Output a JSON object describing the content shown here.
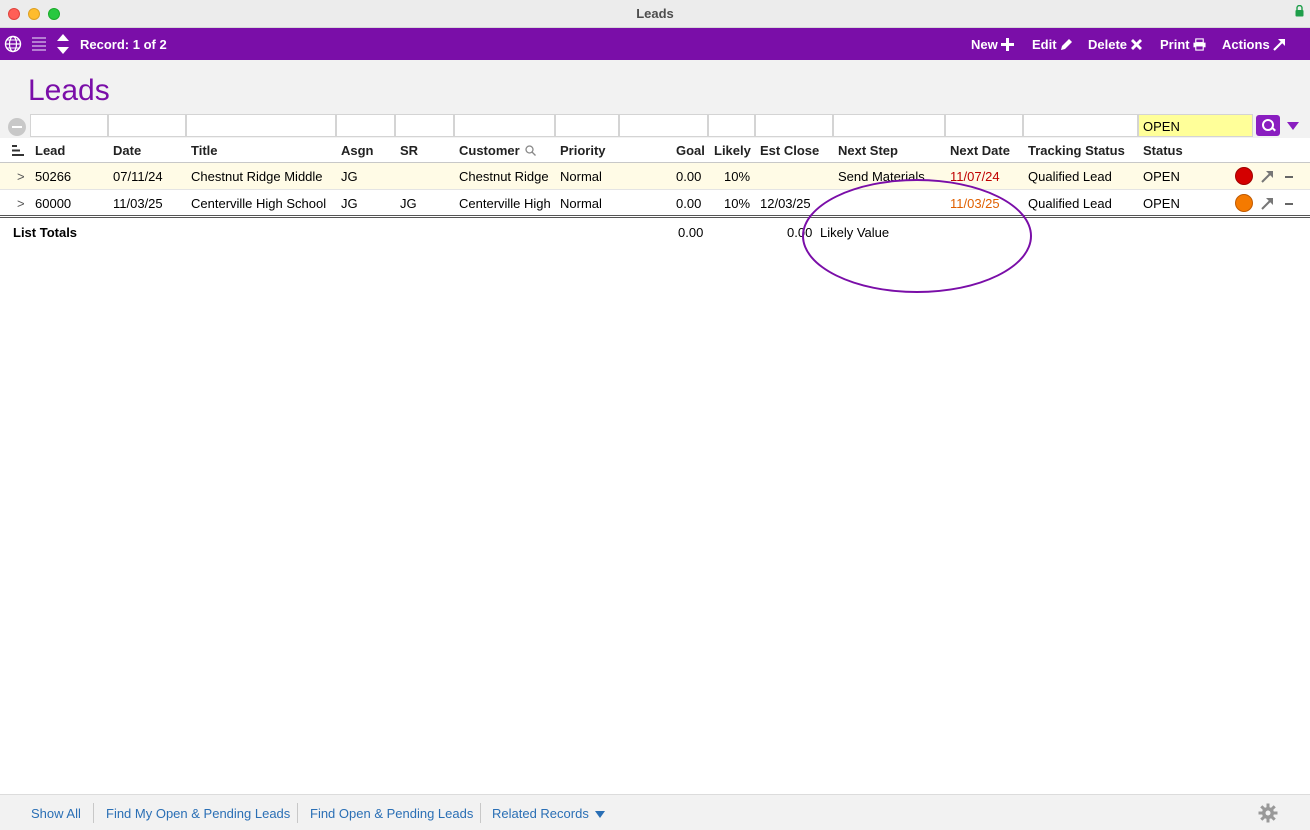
{
  "window": {
    "title": "Leads"
  },
  "toolbar": {
    "record_label": "Record: 1 of 2",
    "new_label": "New",
    "edit_label": "Edit",
    "delete_label": "Delete",
    "print_label": "Print",
    "actions_label": "Actions"
  },
  "page": {
    "title": "Leads"
  },
  "filter": {
    "status_value": "OPEN"
  },
  "columns": {
    "lead": "Lead",
    "date": "Date",
    "title": "Title",
    "asgn": "Asgn",
    "sr": "SR",
    "customer": "Customer",
    "priority": "Priority",
    "goal": "Goal",
    "likely": "Likely",
    "est_close": "Est Close",
    "next_step": "Next Step",
    "next_date": "Next Date",
    "tracking_status": "Tracking Status",
    "status": "Status"
  },
  "rows": [
    {
      "expander": ">",
      "lead": "50266",
      "date": "07/11/24",
      "title": "Chestnut Ridge Middle",
      "asgn": "JG",
      "sr": "",
      "customer": "Chestnut Ridge",
      "priority": "Normal",
      "goal": "0.00",
      "likely": "10%",
      "est_close": "",
      "next_step": "Send Materials",
      "next_date": "11/07/24",
      "next_date_color": "#c00000",
      "tracking_status": "Qualified Lead",
      "status": "OPEN",
      "indicator_color": "#d40000"
    },
    {
      "expander": ">",
      "lead": "60000",
      "date": "11/03/25",
      "title": "Centerville High School",
      "asgn": "JG",
      "sr": "JG",
      "customer": "Centerville High",
      "priority": "Normal",
      "goal": "0.00",
      "likely": "10%",
      "est_close": "12/03/25",
      "next_step": "",
      "next_date": "11/03/25",
      "next_date_color": "#e06000",
      "tracking_status": "Qualified Lead",
      "status": "OPEN",
      "indicator_color": "#f57a00"
    }
  ],
  "totals": {
    "label": "List Totals",
    "goal_total": "0.00",
    "likely_value_total": "0.00",
    "likely_value_label": "Likely Value"
  },
  "footer": {
    "show_all": "Show All",
    "find_my_open": "Find My Open & Pending Leads",
    "find_open": "Find Open & Pending Leads",
    "related_records": "Related Records"
  },
  "colors": {
    "accent": "#7a0ea8",
    "link": "#2a6fb5",
    "filter_highlight": "#ffff99"
  }
}
